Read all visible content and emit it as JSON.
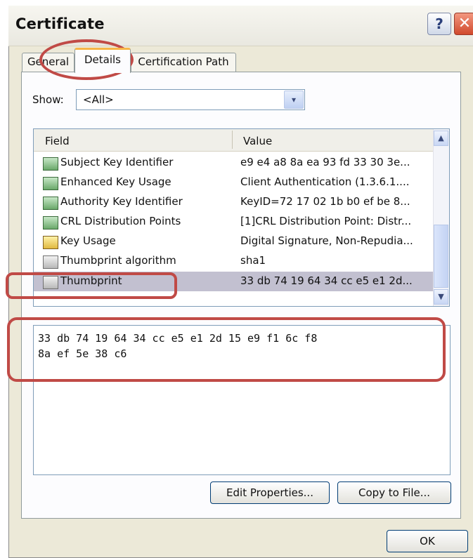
{
  "window": {
    "title": "Certificate"
  },
  "titlebar": {
    "help_label": "?",
    "close_label": "✕"
  },
  "tabs": [
    {
      "label": "General"
    },
    {
      "label": "Details"
    },
    {
      "label": "Certification Path"
    }
  ],
  "show": {
    "label": "Show:",
    "value": "<All>",
    "arrow": "▾"
  },
  "list": {
    "columns": [
      "Field",
      "Value"
    ],
    "rows": [
      {
        "icon": "certificate-extension-icon",
        "field": "Subject Key Identifier",
        "value": "e9 e4 a8 8a ea 93 fd 33 30 3e..."
      },
      {
        "icon": "certificate-extension-icon",
        "field": "Enhanced Key Usage",
        "value": "Client Authentication (1.3.6.1...."
      },
      {
        "icon": "certificate-extension-icon",
        "field": "Authority Key Identifier",
        "value": "KeyID=72 17 02 1b b0 ef be 8..."
      },
      {
        "icon": "certificate-extension-icon",
        "field": "CRL Distribution Points",
        "value": "[1]CRL Distribution Point: Distr..."
      },
      {
        "icon": "critical-extension-warning-icon",
        "field": "Key Usage",
        "value": "Digital Signature, Non-Repudia..."
      },
      {
        "icon": "property-icon",
        "field": "Thumbprint algorithm",
        "value": "sha1"
      },
      {
        "icon": "property-icon",
        "field": "Thumbprint",
        "value": "33 db 74 19 64 34 cc e5 e1 2d...",
        "selected": true
      }
    ],
    "scroll_up": "▲",
    "scroll_down": "▼"
  },
  "detail": {
    "text": "33 db 74 19 64 34 cc e5 e1 2d 15 e9 f1 6c f8\n8a ef 5e 38 c6"
  },
  "buttons": {
    "edit_properties": "Edit Properties...",
    "copy_to_file": "Copy to File...",
    "ok": "OK"
  },
  "colors": {
    "annotation": "#c04a46",
    "selection": "#c2c0d0",
    "active_tab_accent": "#f7b547"
  }
}
